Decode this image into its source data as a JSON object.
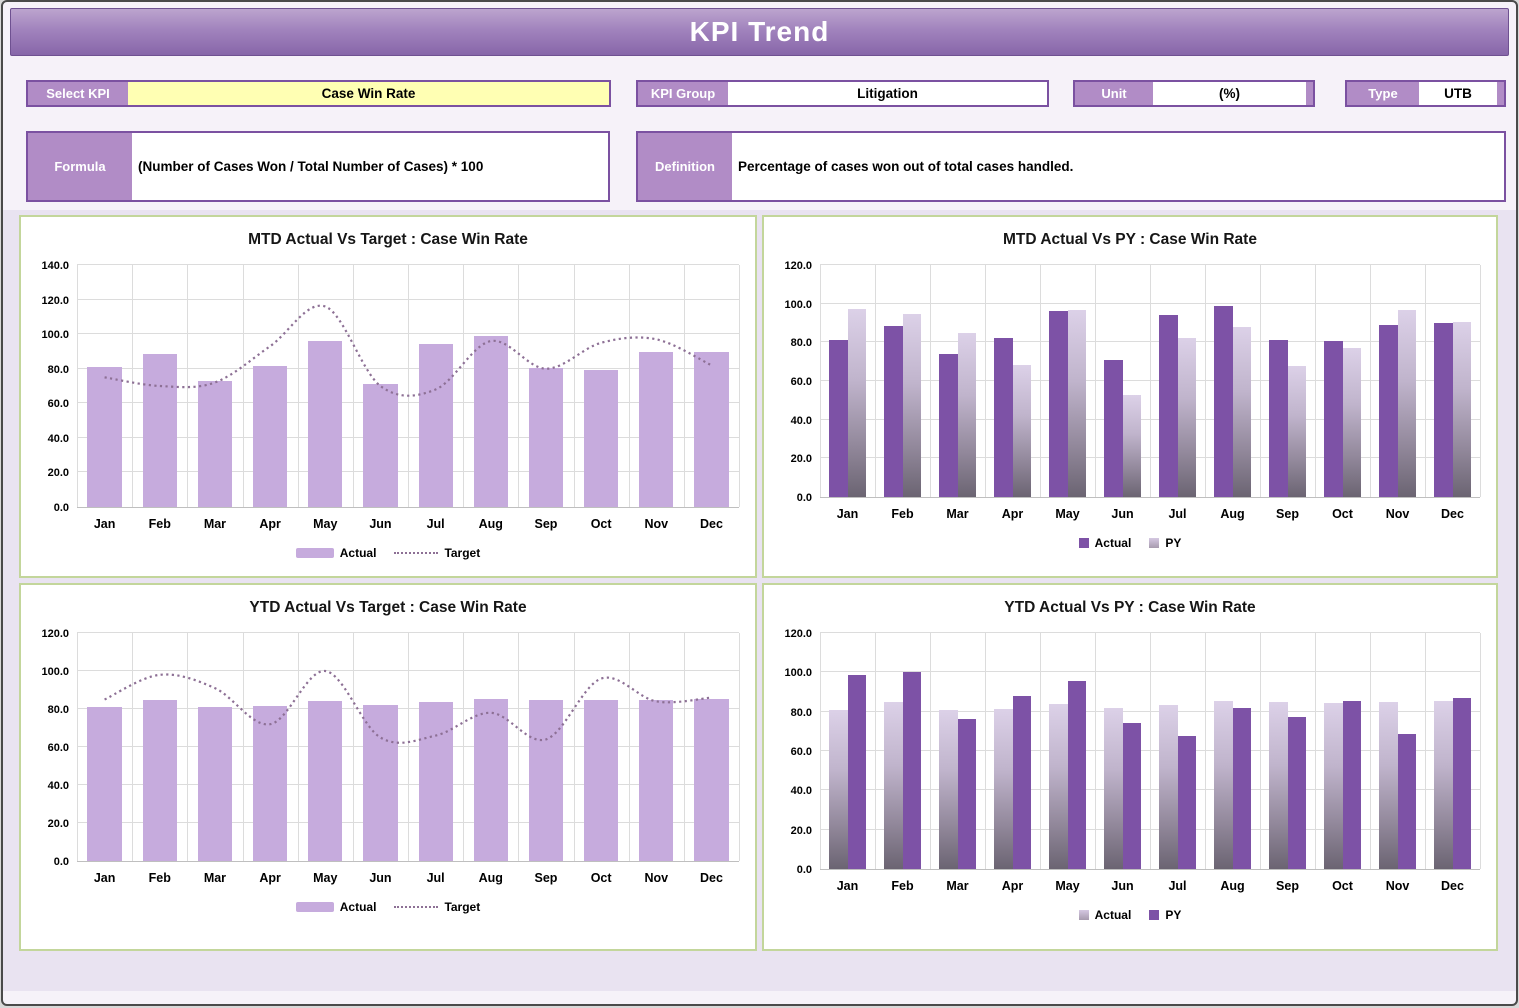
{
  "header": {
    "title": "KPI Trend"
  },
  "fields": {
    "select_kpi": {
      "label": "Select KPI",
      "value": "Case Win Rate"
    },
    "kpi_group": {
      "label": "KPI Group",
      "value": "Litigation"
    },
    "unit": {
      "label": "Unit",
      "value": "(%)"
    },
    "type": {
      "label": "Type",
      "value": "UTB"
    },
    "formula": {
      "label": "Formula",
      "value": "(Number of Cases Won / Total Number of Cases) * 100"
    },
    "definition": {
      "label": "Definition",
      "value": "Percentage of cases won out of total cases handled."
    }
  },
  "colors": {
    "banner_top": "#bca4ce",
    "banner_bottom": "#8766a9",
    "label_bg": "#b18cc6",
    "label_border": "#7b51a1",
    "select_value_bg": "#ffffb3",
    "panel_border": "#c3d69b",
    "chart_area_bg": "#e9e3f1",
    "bar_light": "#c6abdd",
    "bar_dark": "#7d52a6",
    "bar_gradient_top": "#dcd1e8",
    "bar_gradient_bottom": "#6b6472",
    "target_line": "#8d7095",
    "gridline": "#dcdcdc"
  },
  "chart_data": [
    {
      "type": "bar+line",
      "title": "MTD Actual Vs Target : Case Win Rate",
      "categories": [
        "Jan",
        "Feb",
        "Mar",
        "Apr",
        "May",
        "Jun",
        "Jul",
        "Aug",
        "Sep",
        "Oct",
        "Nov",
        "Dec"
      ],
      "series": [
        {
          "name": "Actual",
          "kind": "bar",
          "style": "light",
          "values": [
            81,
            88.5,
            73,
            81.5,
            96,
            71,
            94.5,
            99,
            80.5,
            79.5,
            89.5,
            89.5
          ]
        },
        {
          "name": "Target",
          "kind": "line",
          "style": "dotted",
          "values": [
            75,
            70,
            72,
            93,
            116,
            70,
            68,
            96,
            80,
            95,
            97,
            82
          ]
        }
      ],
      "ylim": [
        0,
        140
      ],
      "ytick_step": 20,
      "grid": true,
      "legend_position": "bottom"
    },
    {
      "type": "bar",
      "title": "MTD Actual Vs PY : Case Win Rate",
      "categories": [
        "Jan",
        "Feb",
        "Mar",
        "Apr",
        "May",
        "Jun",
        "Jul",
        "Aug",
        "Sep",
        "Oct",
        "Nov",
        "Dec"
      ],
      "series": [
        {
          "name": "Actual",
          "kind": "bar",
          "style": "dark",
          "values": [
            81,
            88.5,
            74,
            82,
            96,
            71,
            94,
            99,
            81,
            80.5,
            89,
            90
          ]
        },
        {
          "name": "PY",
          "kind": "bar",
          "style": "gradient",
          "values": [
            97.5,
            94.5,
            85,
            68.5,
            96.5,
            53,
            82.5,
            88,
            68,
            77,
            96.5,
            90.5
          ]
        }
      ],
      "ylim": [
        0,
        120
      ],
      "ytick_step": 20,
      "grid": true,
      "legend_position": "bottom"
    },
    {
      "type": "bar+line",
      "title": "YTD Actual Vs Target : Case Win Rate",
      "categories": [
        "Jan",
        "Feb",
        "Mar",
        "Apr",
        "May",
        "Jun",
        "Jul",
        "Aug",
        "Sep",
        "Oct",
        "Nov",
        "Dec"
      ],
      "series": [
        {
          "name": "Actual",
          "kind": "bar",
          "style": "light",
          "values": [
            81,
            85,
            81,
            81.5,
            84,
            82,
            83.5,
            85.5,
            85,
            84.5,
            85,
            85.5
          ]
        },
        {
          "name": "Target",
          "kind": "line",
          "style": "dotted",
          "values": [
            85,
            98,
            91,
            72,
            100,
            65,
            66,
            78,
            64,
            96,
            84,
            86
          ]
        }
      ],
      "ylim": [
        0,
        120
      ],
      "ytick_step": 20,
      "grid": true,
      "legend_position": "bottom"
    },
    {
      "type": "bar",
      "title": "YTD Actual Vs PY : Case Win Rate",
      "categories": [
        "Jan",
        "Feb",
        "Mar",
        "Apr",
        "May",
        "Jun",
        "Jul",
        "Aug",
        "Sep",
        "Oct",
        "Nov",
        "Dec"
      ],
      "series": [
        {
          "name": "Actual",
          "kind": "bar",
          "style": "gradient",
          "values": [
            81,
            85,
            81,
            81.5,
            84,
            82,
            83.5,
            85.5,
            85,
            84.5,
            85,
            85.5
          ]
        },
        {
          "name": "PY",
          "kind": "bar",
          "style": "dark",
          "values": [
            98.5,
            100,
            76.5,
            88,
            95.5,
            74,
            67.5,
            82,
            77.5,
            85.5,
            68.5,
            87
          ]
        }
      ],
      "ylim": [
        0,
        120
      ],
      "ytick_step": 20,
      "grid": true,
      "legend_position": "bottom"
    }
  ]
}
